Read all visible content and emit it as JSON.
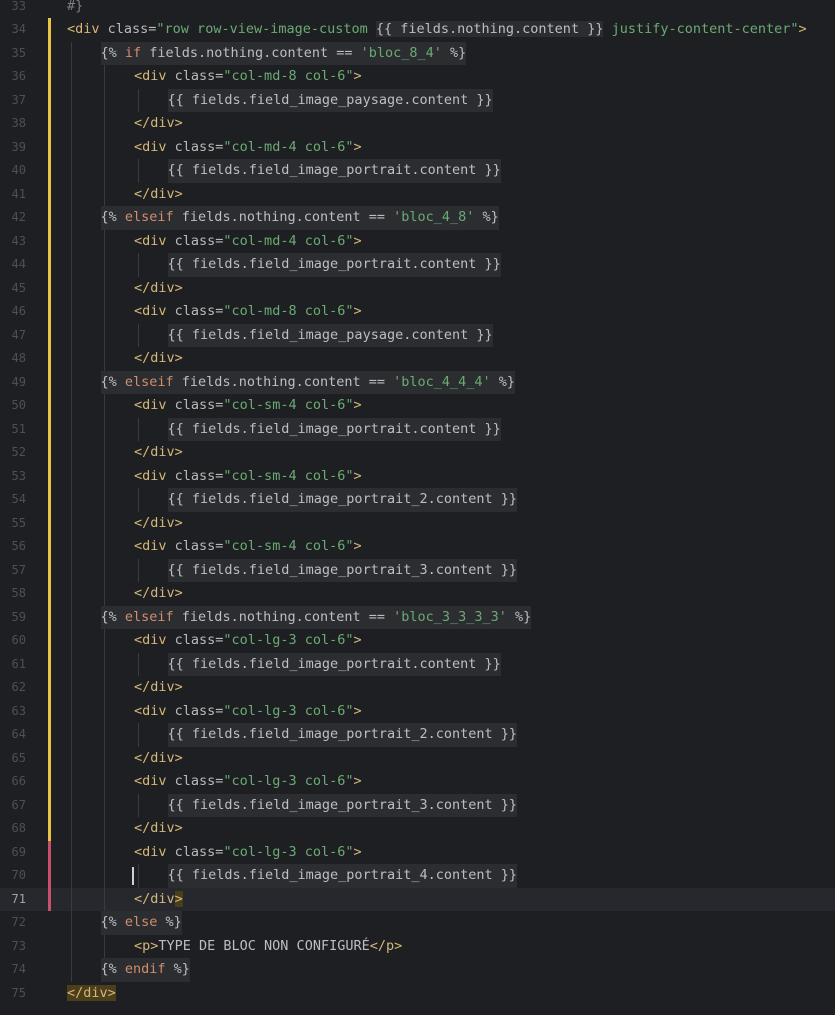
{
  "editor": {
    "current_line": "71",
    "lines": [
      {
        "n": "33",
        "i": 0,
        "t": [
          {
            "c": "t-com",
            "s": "#}"
          }
        ]
      },
      {
        "n": "34",
        "i": 0,
        "t": [
          {
            "c": "t-tag",
            "s": "<div"
          },
          {
            "c": "t-attr",
            "s": " class="
          },
          {
            "c": "t-val",
            "s": "\"row row-view-image-custom "
          },
          {
            "c": "twig",
            "s": "{{ fields.nothing.content }}"
          },
          {
            "c": "t-val",
            "s": " justify-content-center\""
          },
          {
            "c": "t-tag",
            "s": ">"
          }
        ]
      },
      {
        "n": "35",
        "i": 1,
        "twig": true,
        "t": [
          {
            "s": "{% "
          },
          {
            "c": "t-kw",
            "s": "if"
          },
          {
            "s": " fields.nothing.content == "
          },
          {
            "c": "t-val",
            "s": "'bloc_8_4'"
          },
          {
            "s": " %}"
          }
        ]
      },
      {
        "n": "36",
        "i": 2,
        "t": [
          {
            "c": "t-tag",
            "s": "<div"
          },
          {
            "c": "t-attr",
            "s": " class="
          },
          {
            "c": "t-val",
            "s": "\"col-md-8 col-6\""
          },
          {
            "c": "t-tag",
            "s": ">"
          }
        ]
      },
      {
        "n": "37",
        "i": 3,
        "twig": true,
        "t": [
          {
            "s": "{{ fields.field_image_paysage.content }}"
          }
        ]
      },
      {
        "n": "38",
        "i": 2,
        "t": [
          {
            "c": "t-tag",
            "s": "</div>"
          }
        ]
      },
      {
        "n": "39",
        "i": 2,
        "t": [
          {
            "c": "t-tag",
            "s": "<div"
          },
          {
            "c": "t-attr",
            "s": " class="
          },
          {
            "c": "t-val",
            "s": "\"col-md-4 col-6\""
          },
          {
            "c": "t-tag",
            "s": ">"
          }
        ]
      },
      {
        "n": "40",
        "i": 3,
        "twig": true,
        "t": [
          {
            "s": "{{ fields.field_image_portrait.content }}"
          }
        ]
      },
      {
        "n": "41",
        "i": 2,
        "t": [
          {
            "c": "t-tag",
            "s": "</div>"
          }
        ]
      },
      {
        "n": "42",
        "i": 1,
        "twig": true,
        "t": [
          {
            "s": "{% "
          },
          {
            "c": "t-kw",
            "s": "elseif"
          },
          {
            "s": " fields.nothing.content == "
          },
          {
            "c": "t-val",
            "s": "'bloc_4_8'"
          },
          {
            "s": " %}"
          }
        ]
      },
      {
        "n": "43",
        "i": 2,
        "t": [
          {
            "c": "t-tag",
            "s": "<div"
          },
          {
            "c": "t-attr",
            "s": " class="
          },
          {
            "c": "t-val",
            "s": "\"col-md-4 col-6\""
          },
          {
            "c": "t-tag",
            "s": ">"
          }
        ]
      },
      {
        "n": "44",
        "i": 3,
        "twig": true,
        "t": [
          {
            "s": "{{ fields.field_image_portrait.content }}"
          }
        ]
      },
      {
        "n": "45",
        "i": 2,
        "t": [
          {
            "c": "t-tag",
            "s": "</div>"
          }
        ]
      },
      {
        "n": "46",
        "i": 2,
        "t": [
          {
            "c": "t-tag",
            "s": "<div"
          },
          {
            "c": "t-attr",
            "s": " class="
          },
          {
            "c": "t-val",
            "s": "\"col-md-8 col-6\""
          },
          {
            "c": "t-tag",
            "s": ">"
          }
        ]
      },
      {
        "n": "47",
        "i": 3,
        "twig": true,
        "t": [
          {
            "s": "{{ fields.field_image_paysage.content }}"
          }
        ]
      },
      {
        "n": "48",
        "i": 2,
        "t": [
          {
            "c": "t-tag",
            "s": "</div>"
          }
        ]
      },
      {
        "n": "49",
        "i": 1,
        "twig": true,
        "t": [
          {
            "s": "{% "
          },
          {
            "c": "t-kw",
            "s": "elseif"
          },
          {
            "s": " fields.nothing.content == "
          },
          {
            "c": "t-val",
            "s": "'bloc_4_4_4'"
          },
          {
            "s": " %}"
          }
        ]
      },
      {
        "n": "50",
        "i": 2,
        "t": [
          {
            "c": "t-tag",
            "s": "<div"
          },
          {
            "c": "t-attr",
            "s": " class="
          },
          {
            "c": "t-val",
            "s": "\"col-sm-4 col-6\""
          },
          {
            "c": "t-tag",
            "s": ">"
          }
        ]
      },
      {
        "n": "51",
        "i": 3,
        "twig": true,
        "t": [
          {
            "s": "{{ fields.field_image_portrait.content }}"
          }
        ]
      },
      {
        "n": "52",
        "i": 2,
        "t": [
          {
            "c": "t-tag",
            "s": "</div>"
          }
        ]
      },
      {
        "n": "53",
        "i": 2,
        "t": [
          {
            "c": "t-tag",
            "s": "<div"
          },
          {
            "c": "t-attr",
            "s": " class="
          },
          {
            "c": "t-val",
            "s": "\"col-sm-4 col-6\""
          },
          {
            "c": "t-tag",
            "s": ">"
          }
        ]
      },
      {
        "n": "54",
        "i": 3,
        "twig": true,
        "t": [
          {
            "s": "{{ fields.field_image_portrait_2.content }}"
          }
        ]
      },
      {
        "n": "55",
        "i": 2,
        "t": [
          {
            "c": "t-tag",
            "s": "</div>"
          }
        ]
      },
      {
        "n": "56",
        "i": 2,
        "t": [
          {
            "c": "t-tag",
            "s": "<div"
          },
          {
            "c": "t-attr",
            "s": " class="
          },
          {
            "c": "t-val",
            "s": "\"col-sm-4 col-6\""
          },
          {
            "c": "t-tag",
            "s": ">"
          }
        ]
      },
      {
        "n": "57",
        "i": 3,
        "twig": true,
        "t": [
          {
            "s": "{{ fields.field_image_portrait_3.content }}"
          }
        ]
      },
      {
        "n": "58",
        "i": 2,
        "t": [
          {
            "c": "t-tag",
            "s": "</div>"
          }
        ]
      },
      {
        "n": "59",
        "i": 1,
        "twig": true,
        "t": [
          {
            "s": "{% "
          },
          {
            "c": "t-kw",
            "s": "elseif"
          },
          {
            "s": " fields.nothing.content == "
          },
          {
            "c": "t-val",
            "s": "'bloc_3_3_3_3'"
          },
          {
            "s": " %}"
          }
        ]
      },
      {
        "n": "60",
        "i": 2,
        "t": [
          {
            "c": "t-tag",
            "s": "<div"
          },
          {
            "c": "t-attr",
            "s": " class="
          },
          {
            "c": "t-val",
            "s": "\"col-lg-3 col-6\""
          },
          {
            "c": "t-tag",
            "s": ">"
          }
        ]
      },
      {
        "n": "61",
        "i": 3,
        "twig": true,
        "t": [
          {
            "s": "{{ fields.field_image_portrait.content }}"
          }
        ]
      },
      {
        "n": "62",
        "i": 2,
        "t": [
          {
            "c": "t-tag",
            "s": "</div>"
          }
        ]
      },
      {
        "n": "63",
        "i": 2,
        "t": [
          {
            "c": "t-tag",
            "s": "<div"
          },
          {
            "c": "t-attr",
            "s": " class="
          },
          {
            "c": "t-val",
            "s": "\"col-lg-3 col-6\""
          },
          {
            "c": "t-tag",
            "s": ">"
          }
        ]
      },
      {
        "n": "64",
        "i": 3,
        "twig": true,
        "t": [
          {
            "s": "{{ fields.field_image_portrait_2.content }}"
          }
        ]
      },
      {
        "n": "65",
        "i": 2,
        "t": [
          {
            "c": "t-tag",
            "s": "</div>"
          }
        ]
      },
      {
        "n": "66",
        "i": 2,
        "t": [
          {
            "c": "t-tag",
            "s": "<div"
          },
          {
            "c": "t-attr",
            "s": " class="
          },
          {
            "c": "t-val",
            "s": "\"col-lg-3 col-6\""
          },
          {
            "c": "t-tag",
            "s": ">"
          }
        ]
      },
      {
        "n": "67",
        "i": 3,
        "twig": true,
        "t": [
          {
            "s": "{{ fields.field_image_portrait_3.content }}"
          }
        ]
      },
      {
        "n": "68",
        "i": 2,
        "t": [
          {
            "c": "t-tag",
            "s": "</div>"
          }
        ]
      },
      {
        "n": "69",
        "i": 2,
        "t": [
          {
            "c": "t-tag",
            "s": "<"
          },
          {
            "c": "t-tag",
            "s": "div"
          },
          {
            "c": "t-attr",
            "s": " class="
          },
          {
            "c": "t-val",
            "s": "\"col-lg-3 col-6\""
          },
          {
            "c": "t-tag",
            "s": ">"
          }
        ]
      },
      {
        "n": "70",
        "i": 3,
        "twig": true,
        "t": [
          {
            "s": "{{ fields.field_image_portrait_4.content }}"
          }
        ]
      },
      {
        "n": "71",
        "i": 2,
        "t": [
          {
            "c": "t-tag",
            "s": "</div"
          },
          {
            "c": "t-tag bm",
            "s": ">"
          }
        ]
      },
      {
        "n": "72",
        "i": 1,
        "twig": true,
        "t": [
          {
            "s": "{% "
          },
          {
            "c": "t-kw",
            "s": "else"
          },
          {
            "s": " %}"
          }
        ]
      },
      {
        "n": "73",
        "i": 2,
        "t": [
          {
            "c": "t-tag",
            "s": "<p>"
          },
          {
            "s": "TYPE DE BLOC NON CONFIGURÉ"
          },
          {
            "c": "t-tag",
            "s": "</p>"
          }
        ]
      },
      {
        "n": "74",
        "i": 1,
        "twig": true,
        "t": [
          {
            "s": "{% "
          },
          {
            "c": "t-kw",
            "s": "endif"
          },
          {
            "s": " %}"
          }
        ]
      },
      {
        "n": "75",
        "i": 0,
        "t": [
          {
            "c": "t-tag bm",
            "s": "</div>"
          }
        ]
      }
    ]
  },
  "colors": {
    "background": "#1e1f22",
    "current_line_bg": "#26282e",
    "vcs_modified": "#e8c547",
    "vcs_changed": "#c94f6d"
  }
}
